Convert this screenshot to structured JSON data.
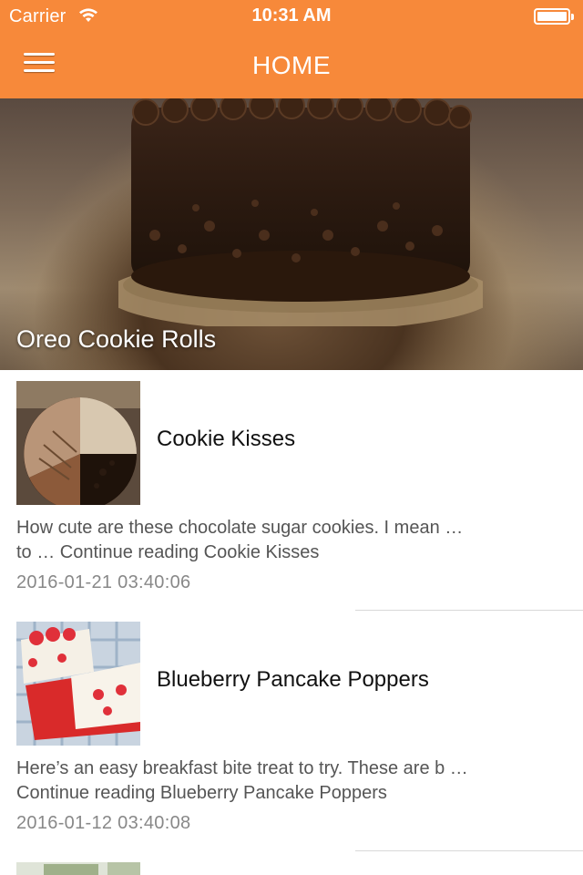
{
  "status_bar": {
    "carrier": "Carrier",
    "time": "10:31 AM"
  },
  "nav": {
    "title": "HOME",
    "bar_color": "#f7893a",
    "menu_icon": "hamburger-menu-icon"
  },
  "featured": {
    "title": "Oreo Cookie Rolls"
  },
  "posts": [
    {
      "title": "Cookie Kisses",
      "excerpt_line1": "How cute are these chocolate sugar cookies. I mean …",
      "excerpt_line2": "to … Continue reading Cookie Kisses",
      "date": "2016-01-21 03:40:06"
    },
    {
      "title": "Blueberry Pancake Poppers",
      "excerpt_line1": "Here’s an easy breakfast bite treat to try. These are b …",
      "excerpt_line2": "Continue reading Blueberry Pancake Poppers",
      "date": "2016-01-12 03:40:08"
    }
  ]
}
